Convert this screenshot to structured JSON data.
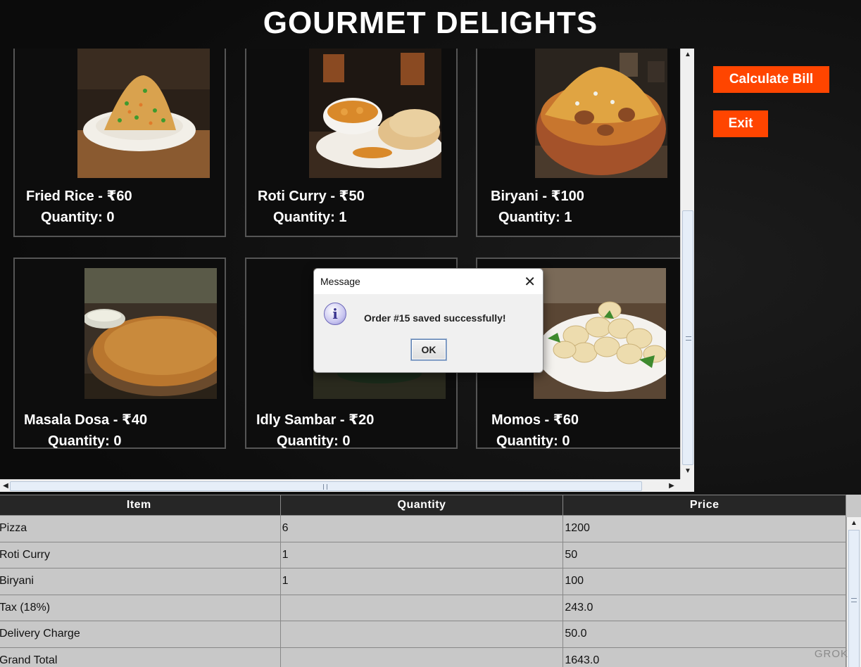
{
  "header": {
    "title": "GOURMET DELIGHTS"
  },
  "menu_items": [
    {
      "name": "Fried Rice - ₹60",
      "quantity": "Quantity: 0",
      "image_icon": "fried-rice-photo"
    },
    {
      "name": "Roti Curry - ₹50",
      "quantity": "Quantity: 1",
      "image_icon": "roti-curry-photo"
    },
    {
      "name": "Biryani - ₹100",
      "quantity": "Quantity: 1",
      "image_icon": "biryani-photo"
    },
    {
      "name": "Masala Dosa - ₹40",
      "quantity": "Quantity: 0",
      "image_icon": "masala-dosa-photo"
    },
    {
      "name": "Idly Sambar - ₹20",
      "quantity": "Quantity: 0",
      "image_icon": "idly-sambar-photo"
    },
    {
      "name": "Momos - ₹60",
      "quantity": "Quantity: 0",
      "image_icon": "momos-photo"
    }
  ],
  "actions": {
    "calculate_bill_label": "Calculate Bill",
    "exit_label": "Exit",
    "accent_color": "#ff4500"
  },
  "bill_table": {
    "columns": [
      "Item",
      "Quantity",
      "Price"
    ],
    "rows": [
      [
        "Pizza",
        "6",
        "1200"
      ],
      [
        "Roti Curry",
        "1",
        "50"
      ],
      [
        "Biryani",
        "1",
        "100"
      ],
      [
        "Tax (18%)",
        "",
        "243.0"
      ],
      [
        "Delivery Charge",
        "",
        "50.0"
      ],
      [
        "Grand Total",
        "",
        "1643.0"
      ]
    ]
  },
  "dialog": {
    "title": "Message",
    "message": "Order #15 saved successfully!",
    "ok_label": "OK",
    "icon": "info-icon"
  },
  "watermark": "GROK"
}
